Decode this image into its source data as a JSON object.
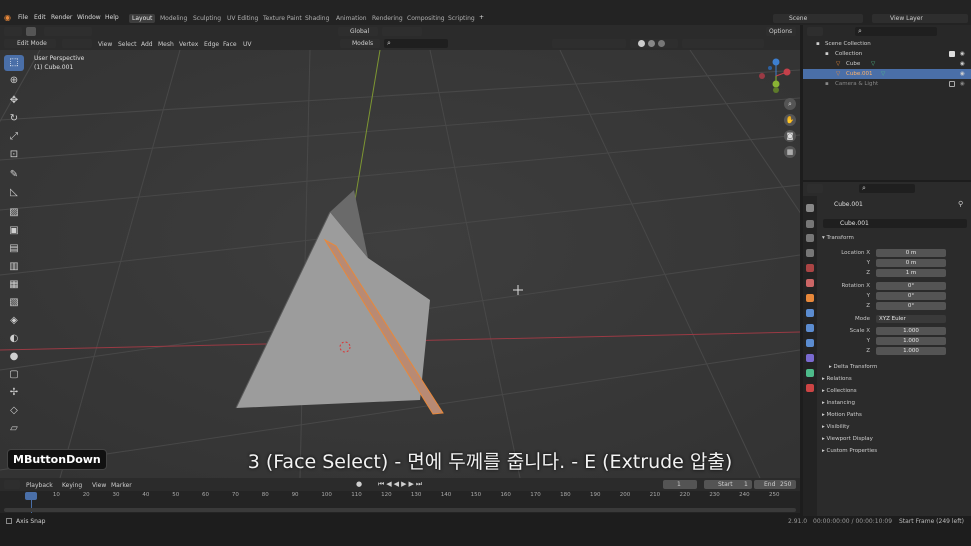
{
  "topbar": {
    "menus": [
      "File",
      "Edit",
      "Render",
      "Window",
      "Help"
    ],
    "workspaces": [
      "Layout",
      "Modeling",
      "Sculpting",
      "UV Editing",
      "Texture Paint",
      "Shading",
      "Animation",
      "Rendering",
      "Compositing",
      "Scripting"
    ],
    "active_workspace": "Layout",
    "add_tab": "+",
    "scene": "Scene",
    "view_layer": "View Layer"
  },
  "viewport_header": {
    "mode": "Edit Mode",
    "menus": [
      "View",
      "Select",
      "Add",
      "Mesh",
      "Vertex",
      "Edge",
      "Face",
      "UV"
    ],
    "transform_orientation": "Global",
    "models": "Models",
    "options": "Options"
  },
  "viewport": {
    "perspective": "User Perspective",
    "object": "(1) Cube.001",
    "gizmo_axes": [
      "X",
      "Y",
      "Z"
    ]
  },
  "outliner": {
    "rows": [
      {
        "label": "Scene Collection"
      },
      {
        "label": "Collection"
      },
      {
        "label": "Cube"
      },
      {
        "label": "Cube.001"
      },
      {
        "label": "Camera & Light"
      }
    ]
  },
  "properties": {
    "object_name": "Cube.001",
    "data_name": "Cube.001",
    "transform_label": "Transform",
    "location": {
      "label": "Location X",
      "x": "0 m",
      "y": "0 m",
      "z": "1 m"
    },
    "rotation": {
      "label": "Rotation X",
      "x": "0°",
      "y": "0°",
      "z": "0°"
    },
    "mode_label": "Mode",
    "mode_value": "XYZ Euler",
    "scale": {
      "label": "Scale X",
      "x": "1.000",
      "y": "1.000",
      "z": "1.000"
    },
    "axis_y": "Y",
    "axis_z": "Z",
    "sections": [
      "Delta Transform",
      "Relations",
      "Collections",
      "Instancing",
      "Motion Paths",
      "Visibility",
      "Viewport Display",
      "Custom Properties"
    ]
  },
  "timeline": {
    "menus": [
      "Playback",
      "Keying",
      "View",
      "Marker"
    ],
    "current_frame": "1",
    "start_label": "Start",
    "start": "1",
    "end_label": "End",
    "end": "250",
    "ticks": [
      "1",
      "10",
      "20",
      "30",
      "40",
      "50",
      "60",
      "70",
      "80",
      "90",
      "100",
      "110",
      "120",
      "130",
      "140",
      "150",
      "160",
      "170",
      "180",
      "190",
      "200",
      "210",
      "220",
      "230",
      "240",
      "250"
    ]
  },
  "status_bar": {
    "left": "Axis Snap",
    "version": "2.91.0",
    "time": "00:00:00:00 / 00:00:10:09",
    "frame_info": "Start Frame (249 left)"
  },
  "overlay": {
    "key_display": "MButtonDown",
    "caption": "3 (Face Select) - 면에 두께를 줍니다. - E (Extrude 압출)"
  },
  "colors": {
    "accent": "#4a6fa8",
    "orange": "#e8883a",
    "x_axis": "#c5404a",
    "y_axis": "#8ab434",
    "z_axis": "#3d7fd0"
  }
}
